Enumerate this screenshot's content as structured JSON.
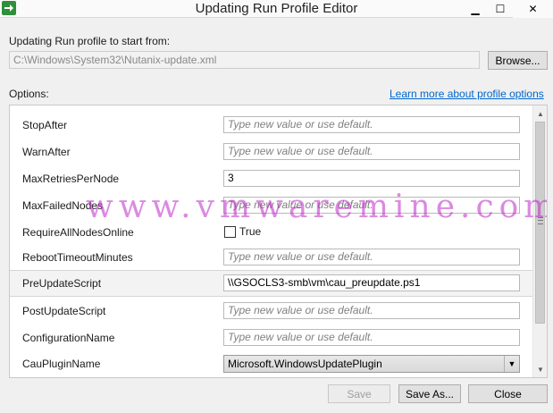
{
  "window": {
    "title": "Updating Run Profile Editor"
  },
  "profile": {
    "label": "Updating Run profile to start from:",
    "path": "C:\\Windows\\System32\\Nutanix-update.xml",
    "browse_label": "Browse..."
  },
  "options": {
    "label": "Options:",
    "learn_more": "Learn more about profile options",
    "rows": [
      {
        "name": "StopAfter",
        "value": "",
        "placeholder": "Type new value or use default."
      },
      {
        "name": "WarnAfter",
        "value": "",
        "placeholder": "Type new value or use default."
      },
      {
        "name": "MaxRetriesPerNode",
        "value": "3",
        "placeholder": ""
      },
      {
        "name": "MaxFailedNodes",
        "value": "",
        "placeholder": "Type new value or use default."
      },
      {
        "name": "RequireAllNodesOnline",
        "checkbox_label": "True",
        "checked": false
      },
      {
        "name": "RebootTimeoutMinutes",
        "value": "",
        "placeholder": "Type new value or use default."
      },
      {
        "name": "PreUpdateScript",
        "value": "\\\\GSOCLS3-smb\\vm\\cau_preupdate.ps1",
        "placeholder": ""
      },
      {
        "name": "PostUpdateScript",
        "value": "",
        "placeholder": "Type new value or use default."
      },
      {
        "name": "ConfigurationName",
        "value": "",
        "placeholder": "Type new value or use default."
      },
      {
        "name": "CauPluginName",
        "value": "Microsoft.WindowsUpdatePlugin"
      }
    ]
  },
  "footer": {
    "save_label": "Save",
    "save_as_label": "Save As...",
    "close_label": "Close"
  },
  "watermark": "www.vmwaremine.com"
}
